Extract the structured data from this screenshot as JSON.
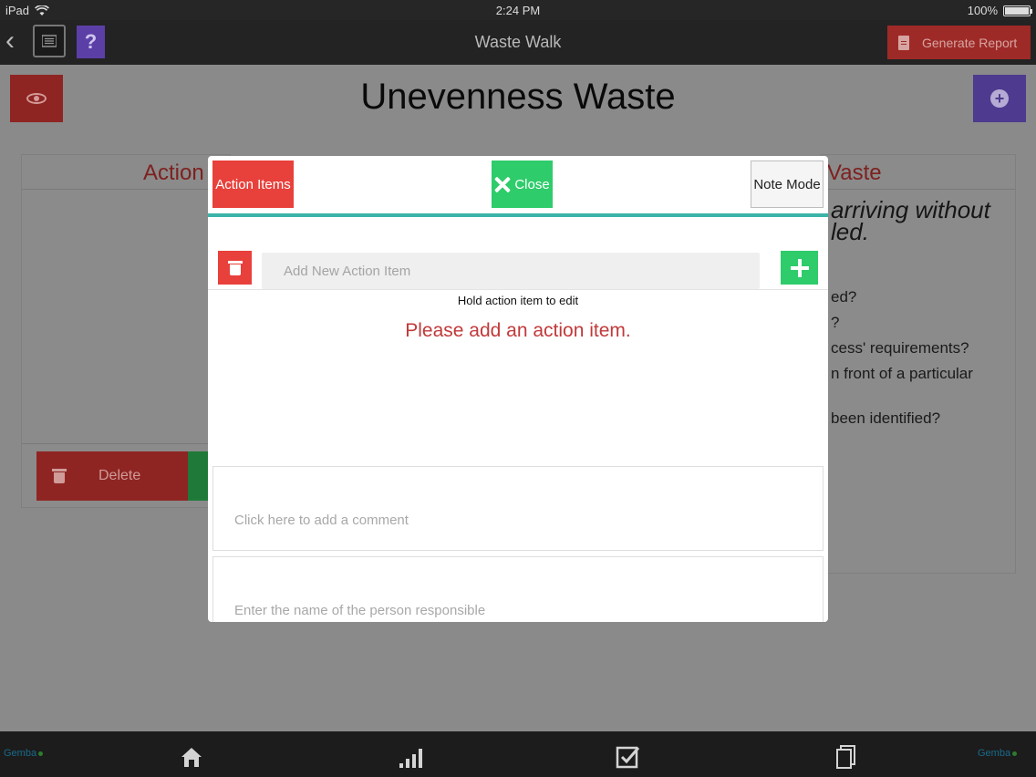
{
  "status_bar": {
    "device": "iPad",
    "time": "2:24 PM",
    "battery": "100%"
  },
  "nav": {
    "title": "Waste Walk",
    "generate_report_label": "Generate Report"
  },
  "page": {
    "title": "Unevenness Waste"
  },
  "left_card": {
    "heading": "Action",
    "delete_label": "Delete"
  },
  "right_card": {
    "heading": "Vaste",
    "description_line1": "arriving without",
    "description_line2": "led.",
    "questions": [
      "ed?",
      "?",
      "cess' requirements?",
      "n front of a particular",
      "been identified?"
    ]
  },
  "modal": {
    "action_items_label": "Action Items",
    "close_label": "Close",
    "note_mode_label": "Note Mode",
    "new_item_placeholder": "Add New Action Item",
    "hint": "Hold action item to edit",
    "empty_message": "Please add an action item.",
    "comment_placeholder": "Click here to add a comment",
    "person_placeholder": "Enter the name of the person responsible"
  },
  "tab_bar": {
    "brand_left": "Gemba",
    "brand_right": "Gemba",
    "items": [
      "home-icon",
      "chart-icon",
      "checklist-icon",
      "documents-icon"
    ]
  },
  "colors": {
    "red": "#e8403b",
    "green": "#2ecc6b",
    "purple": "#5b3fa6",
    "teal": "#3bb3a8"
  }
}
